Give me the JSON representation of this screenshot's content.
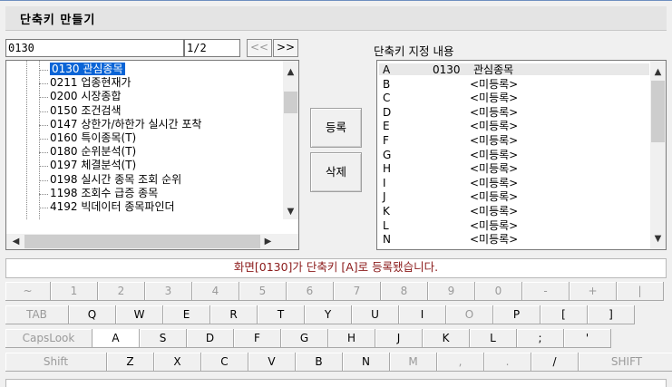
{
  "window": {
    "title": "단축키 만들기"
  },
  "search": {
    "value": "0130",
    "page_indicator": "1/2",
    "prev_label": "<<",
    "next_label": ">>"
  },
  "tree": {
    "items": [
      {
        "code": "0130",
        "name": "관심종목",
        "label": "0130 관심종목",
        "selected": true
      },
      {
        "code": "0211",
        "name": "업종현재가",
        "label": "0211 업종현재가"
      },
      {
        "code": "0200",
        "name": "시장종합",
        "label": "0200 시장종합"
      },
      {
        "code": "0150",
        "name": "조건검색",
        "label": "0150 조건검색"
      },
      {
        "code": "0147",
        "name": "상한가/하한가 실시간 포착",
        "label": "0147 상한가/하한가 실시간 포착"
      },
      {
        "code": "0160",
        "name": "특이종목(T)",
        "label": "0160 특이종목(T)"
      },
      {
        "code": "0180",
        "name": "순위분석(T)",
        "label": "0180 순위분석(T)"
      },
      {
        "code": "0197",
        "name": "체결분석(T)",
        "label": "0197 체결분석(T)"
      },
      {
        "code": "0198",
        "name": "실시간 종목 조회 순위",
        "label": "0198 실시간 종목 조회 순위"
      },
      {
        "code": "1198",
        "name": "조회수 급증 종목",
        "label": "1198 조회수 급증 종목"
      },
      {
        "code": "4192",
        "name": "빅데이터 종목파인더",
        "label": "4192 빅데이터 종목파인더"
      }
    ]
  },
  "actions": {
    "register_label": "등록",
    "delete_label": "삭제"
  },
  "shortcuts": {
    "header": "단축키 지정 내용",
    "rows": [
      {
        "key": "A",
        "code": "0130",
        "name": "관심종목"
      },
      {
        "key": "B",
        "code": "",
        "name": "<미등록>"
      },
      {
        "key": "C",
        "code": "",
        "name": "<미등록>"
      },
      {
        "key": "D",
        "code": "",
        "name": "<미등록>"
      },
      {
        "key": "E",
        "code": "",
        "name": "<미등록>"
      },
      {
        "key": "F",
        "code": "",
        "name": "<미등록>"
      },
      {
        "key": "G",
        "code": "",
        "name": "<미등록>"
      },
      {
        "key": "H",
        "code": "",
        "name": "<미등록>"
      },
      {
        "key": "I",
        "code": "",
        "name": "<미등록>"
      },
      {
        "key": "J",
        "code": "",
        "name": "<미등록>"
      },
      {
        "key": "K",
        "code": "",
        "name": "<미등록>"
      },
      {
        "key": "L",
        "code": "",
        "name": "<미등록>"
      },
      {
        "key": "N",
        "code": "",
        "name": "<미등록>"
      }
    ]
  },
  "status": {
    "message": "화면[0130]가 단축키 [A]로 등록됐습니다."
  },
  "keyboard": {
    "rows": [
      [
        "~",
        "1",
        "2",
        "3",
        "4",
        "5",
        "6",
        "7",
        "8",
        "9",
        "0",
        "-",
        "+",
        "|"
      ],
      [
        "TAB",
        "Q",
        "W",
        "E",
        "R",
        "T",
        "Y",
        "U",
        "I",
        "O",
        "P",
        "[",
        "]"
      ],
      [
        "CapsLook",
        "A",
        "S",
        "D",
        "F",
        "G",
        "H",
        "J",
        "K",
        "L",
        ";",
        "'"
      ],
      [
        "Shift",
        "Z",
        "X",
        "C",
        "V",
        "B",
        "N",
        "M",
        ",",
        ".",
        "/",
        "SHIFT"
      ]
    ],
    "active_key": "A"
  }
}
